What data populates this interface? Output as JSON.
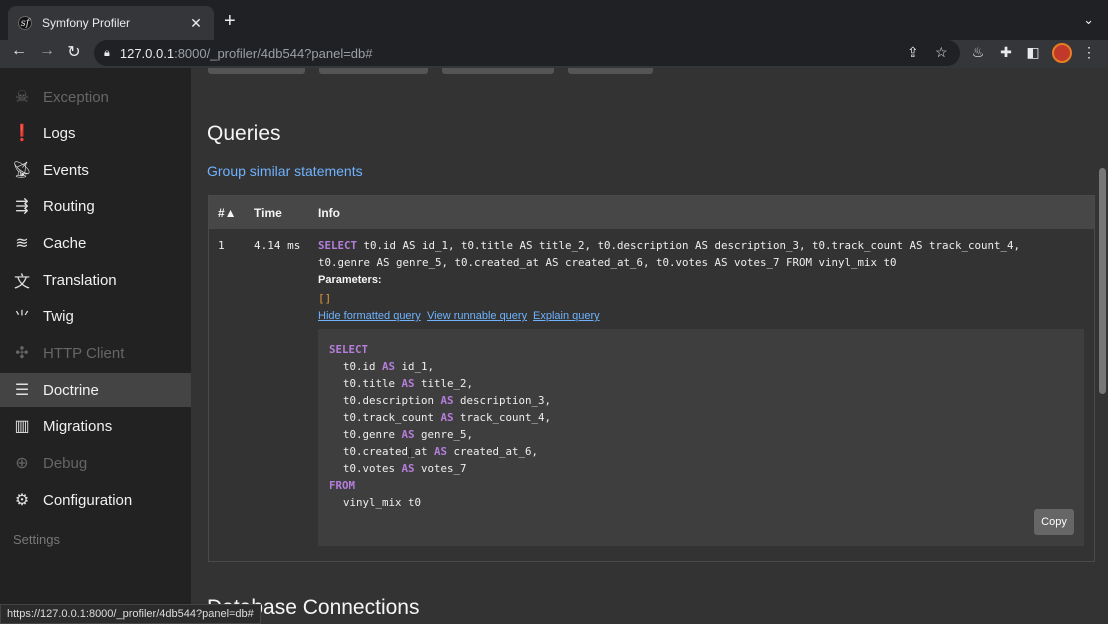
{
  "browser": {
    "tab_title": "Symfony Profiler",
    "tab_favicon": "sf",
    "url_host": "127.0.0.1",
    "url_path": ":8000/_profiler/4db544?panel=db#",
    "status_url": "https://127.0.0.1:8000/_profiler/4db544?panel=db#"
  },
  "sidebar": {
    "items": [
      {
        "label": "Exception",
        "icon": "exception-icon",
        "disabled": true
      },
      {
        "label": "Logs",
        "icon": "logs-icon"
      },
      {
        "label": "Events",
        "icon": "events-icon"
      },
      {
        "label": "Routing",
        "icon": "routing-icon"
      },
      {
        "label": "Cache",
        "icon": "cache-icon"
      },
      {
        "label": "Translation",
        "icon": "translation-icon"
      },
      {
        "label": "Twig",
        "icon": "twig-icon"
      },
      {
        "label": "HTTP Client",
        "icon": "http-client-icon",
        "disabled": true
      },
      {
        "label": "Doctrine",
        "icon": "doctrine-icon",
        "active": true
      },
      {
        "label": "Migrations",
        "icon": "migrations-icon"
      },
      {
        "label": "Debug",
        "icon": "debug-icon",
        "disabled": true
      },
      {
        "label": "Configuration",
        "icon": "configuration-icon"
      }
    ],
    "settings_label": "Settings"
  },
  "main": {
    "queries_heading": "Queries",
    "group_link": "Group similar statements",
    "table_headers": {
      "num": "#▲",
      "time": "Time",
      "info": "Info"
    },
    "query": {
      "num": "1",
      "time": "4.14 ms",
      "sql_line1": "t0.id AS id_1, t0.title AS title_2, t0.description AS description_3, t0.track_count AS track_count_4,",
      "sql_line2": "t0.genre AS genre_5, t0.created_at AS created_at_6, t0.votes AS votes_7 FROM vinyl_mix t0",
      "parameters_label": "Parameters:",
      "parameters_value": "[]",
      "hide_formatted": "Hide formatted query",
      "view_runnable": "View runnable query",
      "explain": "Explain query",
      "copy_label": "Copy"
    },
    "db_connections_heading": "Database Connections"
  }
}
